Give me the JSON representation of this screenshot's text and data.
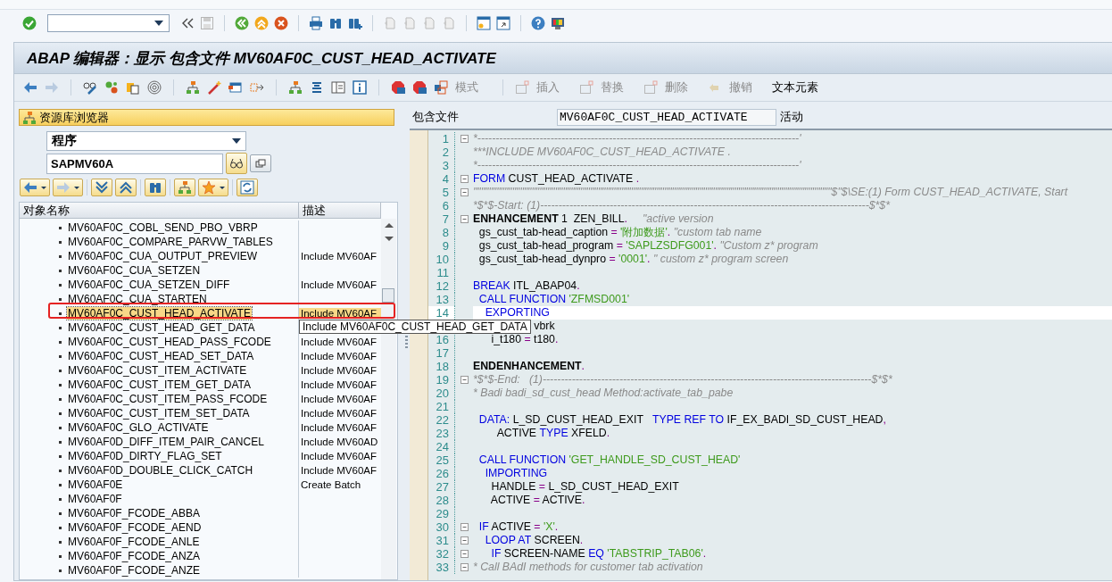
{
  "title": "ABAP 编辑器：显示 包含文件 MV60AF0C_CUST_HEAD_ACTIVATE",
  "app_toolbar": [
    {
      "label": "模式",
      "disabled": true
    },
    {
      "label": "插入",
      "disabled": true
    },
    {
      "label": "替换",
      "disabled": true
    },
    {
      "label": "删除",
      "disabled": true
    },
    {
      "label": "撤销",
      "disabled": true
    },
    {
      "label": "文本元素",
      "disabled": false
    }
  ],
  "repository_browser": {
    "title": "资源库浏览器",
    "object_type": "程序",
    "object_name": "SAPMV60A",
    "columns": [
      "对象名称",
      "描述"
    ],
    "rows": [
      {
        "name": "MV60AF0C_COBL_SEND_PBO_VBRP",
        "selected": false
      },
      {
        "name": "MV60AF0C_COMPARE_PARVW_TABLES",
        "selected": false
      },
      {
        "name": "MV60AF0C_CUA_OUTPUT_PREVIEW",
        "description": "Include MV60AF",
        "selected": false
      },
      {
        "name": "MV60AF0C_CUA_SETZEN",
        "selected": false
      },
      {
        "name": "MV60AF0C_CUA_SETZEN_DIFF",
        "description": "Include MV60AF",
        "selected": false
      },
      {
        "name": "MV60AF0C_CUA_STARTEN",
        "selected": false
      },
      {
        "name": "MV60AF0C_CUST_HEAD_ACTIVATE",
        "description": "Include MV60AF",
        "selected": true
      },
      {
        "name": "MV60AF0C_CUST_HEAD_GET_DATA",
        "tooltip": "Include MV60AF0C_CUST_HEAD_GET_DATA",
        "selected": false
      },
      {
        "name": "MV60AF0C_CUST_HEAD_PASS_FCODE",
        "description": "Include MV60AF",
        "selected": false
      },
      {
        "name": "MV60AF0C_CUST_HEAD_SET_DATA",
        "description": "Include MV60AF",
        "selected": false
      },
      {
        "name": "MV60AF0C_CUST_ITEM_ACTIVATE",
        "description": "Include MV60AF",
        "selected": false
      },
      {
        "name": "MV60AF0C_CUST_ITEM_GET_DATA",
        "description": "Include MV60AF",
        "selected": false
      },
      {
        "name": "MV60AF0C_CUST_ITEM_PASS_FCODE",
        "description": "Include MV60AF",
        "selected": false
      },
      {
        "name": "MV60AF0C_CUST_ITEM_SET_DATA",
        "description": "Include MV60AF",
        "selected": false
      },
      {
        "name": "MV60AF0C_GLO_ACTIVATE",
        "description": "Include MV60AF",
        "selected": false
      },
      {
        "name": "MV60AF0D_DIFF_ITEM_PAIR_CANCEL",
        "description": "Include MV60AD",
        "selected": false
      },
      {
        "name": "MV60AF0D_DIRTY_FLAG_SET",
        "description": "Include MV60AF",
        "selected": false
      },
      {
        "name": "MV60AF0D_DOUBLE_CLICK_CATCH",
        "description": "Include MV60AF",
        "selected": false
      },
      {
        "name": "MV60AF0E",
        "description": "Create Batch",
        "selected": false
      },
      {
        "name": "MV60AF0F",
        "selected": false
      },
      {
        "name": "MV60AF0F_FCODE_ABBA",
        "selected": false
      },
      {
        "name": "MV60AF0F_FCODE_AEND",
        "selected": false
      },
      {
        "name": "MV60AF0F_FCODE_ANLE",
        "selected": false
      },
      {
        "name": "MV60AF0F_FCODE_ANZA",
        "selected": false
      },
      {
        "name": "MV60AF0F_FCODE_ANZE",
        "selected": false
      }
    ]
  },
  "editor": {
    "include_label": "包含文件",
    "include_name": "MV60AF0C_CUST_HEAD_ACTIVATE",
    "status": "活动",
    "lines": [
      {
        "number": "1",
        "fold": true,
        "current": false,
        "tokens": [
          {
            "kind": "comment",
            "text": "*----------------------------------------------------------------------------------------'"
          }
        ]
      },
      {
        "number": "2",
        "fold": false,
        "current": false,
        "tokens": [
          {
            "kind": "comment",
            "text": "***INCLUDE MV60AF0C_CUST_HEAD_ACTIVATE ."
          }
        ]
      },
      {
        "number": "3",
        "fold": false,
        "current": false,
        "tokens": [
          {
            "kind": "comment",
            "text": "*----------------------------------------------------------------------------------------'"
          }
        ]
      },
      {
        "number": "4",
        "fold": true,
        "current": false,
        "tokens": [
          {
            "kind": "keyword",
            "text": "FORM"
          },
          {
            "kind": "plain",
            "text": " CUST_HEAD_ACTIVATE "
          },
          {
            "kind": "op",
            "text": "."
          }
        ]
      },
      {
        "number": "5",
        "fold": true,
        "current": false,
        "tokens": [
          {
            "kind": "comment",
            "text": "\"\"\"\"\"\"\"\"\"\"\"\"\"\"\"\"\"\"\"\"\"\"\"\"\"\"\"\"\"\"\"\"\"\"\"\"\"\"\"\"\"\"\"\"\"\"\"\"\"\"\"\"\"\"\"\"\"\"\"\"\"\"\"\"\"\"\"\"\"\"\"\"\"\"\"\"\"\"\"\"\"\"\"\"\"\"\"\"\"\"\"\"$\"$\\SE:(1) Form CUST_HEAD_ACTIVATE, Start"
          }
        ]
      },
      {
        "number": "6",
        "fold": false,
        "current": false,
        "tokens": [
          {
            "kind": "comment",
            "text": "*$*$-Start: (1)------------------------------------------------------------------------------------------$*$*"
          }
        ]
      },
      {
        "number": "7",
        "fold": true,
        "current": false,
        "tokens": [
          {
            "kind": "bold",
            "text": "ENHANCEMENT"
          },
          {
            "kind": "plain",
            "text": " 1  ZEN_BILL"
          },
          {
            "kind": "op",
            "text": "."
          },
          {
            "kind": "comment",
            "text": "     \"active version"
          }
        ]
      },
      {
        "number": "8",
        "fold": false,
        "current": false,
        "tokens": [
          {
            "kind": "plain",
            "text": "  gs_cust_tab-head_caption "
          },
          {
            "kind": "op",
            "text": "="
          },
          {
            "kind": "string",
            "text": " '附加数据'"
          },
          {
            "kind": "op",
            "text": "."
          },
          {
            "kind": "comment",
            "text": " \"custom tab name"
          }
        ]
      },
      {
        "number": "9",
        "fold": false,
        "current": false,
        "tokens": [
          {
            "kind": "plain",
            "text": "  gs_cust_tab-head_program "
          },
          {
            "kind": "op",
            "text": "="
          },
          {
            "kind": "string",
            "text": " 'SAPLZSDFG001'"
          },
          {
            "kind": "op",
            "text": "."
          },
          {
            "kind": "comment",
            "text": " \"Custom z* program"
          }
        ]
      },
      {
        "number": "10",
        "fold": false,
        "current": false,
        "tokens": [
          {
            "kind": "plain",
            "text": "  gs_cust_tab-head_dynpro "
          },
          {
            "kind": "op",
            "text": "="
          },
          {
            "kind": "string",
            "text": " '0001'"
          },
          {
            "kind": "op",
            "text": "."
          },
          {
            "kind": "comment",
            "text": " \" custom z* program screen"
          }
        ]
      },
      {
        "number": "11",
        "fold": false,
        "current": false
      },
      {
        "number": "12",
        "fold": false,
        "current": false,
        "tokens": [
          {
            "kind": "keyword",
            "text": "BREAK"
          },
          {
            "kind": "plain",
            "text": " ITL_ABAP04"
          },
          {
            "kind": "op",
            "text": "."
          }
        ]
      },
      {
        "number": "13",
        "fold": false,
        "current": false,
        "tokens": [
          {
            "kind": "keyword",
            "text": "  CALL FUNCTION"
          },
          {
            "kind": "string",
            "text": " 'ZFMSD001'"
          }
        ]
      },
      {
        "number": "14",
        "fold": false,
        "current": true,
        "tokens": [
          {
            "kind": "keyword",
            "text": "    EXPORTING"
          }
        ]
      },
      {
        "fold": false,
        "current": false,
        "tokens": [
          {
            "kind": "plain",
            "text": "                    vbrk"
          }
        ]
      },
      {
        "number": "16",
        "fold": false,
        "current": false,
        "tokens": [
          {
            "kind": "plain",
            "text": "      i_t180 "
          },
          {
            "kind": "op",
            "text": "="
          },
          {
            "kind": "plain",
            "text": " t180"
          },
          {
            "kind": "op",
            "text": "."
          }
        ]
      },
      {
        "number": "17",
        "fold": false,
        "current": false
      },
      {
        "number": "18",
        "fold": false,
        "current": false,
        "tokens": [
          {
            "kind": "bold",
            "text": "ENDENHANCEMENT"
          },
          {
            "kind": "op",
            "text": "."
          }
        ]
      },
      {
        "number": "19",
        "fold": true,
        "current": false,
        "tokens": [
          {
            "kind": "comment",
            "text": "*$*$-End:   (1)------------------------------------------------------------------------------------------$*$*"
          }
        ]
      },
      {
        "number": "20",
        "fold": false,
        "current": false,
        "tokens": [
          {
            "kind": "comment",
            "text": "* Badi badi_sd_cust_head Method:activate_tab_pabe"
          }
        ]
      },
      {
        "number": "21",
        "fold": false,
        "current": false
      },
      {
        "number": "22",
        "fold": false,
        "current": false,
        "tokens": [
          {
            "kind": "keyword",
            "text": "  DATA:"
          },
          {
            "kind": "plain",
            "text": " L_SD_CUST_HEAD_EXIT   "
          },
          {
            "kind": "keyword",
            "text": "TYPE REF TO"
          },
          {
            "kind": "plain",
            "text": " IF_EX_BADI_SD_CUST_HEAD"
          },
          {
            "kind": "op",
            "text": ","
          }
        ]
      },
      {
        "number": "23",
        "fold": false,
        "current": false,
        "tokens": [
          {
            "kind": "plain",
            "text": "        ACTIVE "
          },
          {
            "kind": "keyword",
            "text": "TYPE"
          },
          {
            "kind": "plain",
            "text": " XFELD"
          },
          {
            "kind": "op",
            "text": "."
          }
        ]
      },
      {
        "number": "24",
        "fold": false,
        "current": false
      },
      {
        "number": "25",
        "fold": false,
        "current": false,
        "tokens": [
          {
            "kind": "keyword",
            "text": "  CALL FUNCTION"
          },
          {
            "kind": "string",
            "text": " 'GET_HANDLE_SD_CUST_HEAD'"
          }
        ]
      },
      {
        "number": "26",
        "fold": false,
        "current": false,
        "tokens": [
          {
            "kind": "keyword",
            "text": "    IMPORTING"
          }
        ]
      },
      {
        "number": "27",
        "fold": false,
        "current": false,
        "tokens": [
          {
            "kind": "plain",
            "text": "      HANDLE "
          },
          {
            "kind": "op",
            "text": "="
          },
          {
            "kind": "plain",
            "text": " L_SD_CUST_HEAD_EXIT"
          }
        ]
      },
      {
        "number": "28",
        "fold": false,
        "current": false,
        "tokens": [
          {
            "kind": "plain",
            "text": "      ACTIVE "
          },
          {
            "kind": "op",
            "text": "="
          },
          {
            "kind": "plain",
            "text": " ACTIVE"
          },
          {
            "kind": "op",
            "text": "."
          }
        ]
      },
      {
        "number": "29",
        "fold": false,
        "current": false
      },
      {
        "number": "30",
        "fold": true,
        "current": false,
        "tokens": [
          {
            "kind": "keyword",
            "text": "  IF"
          },
          {
            "kind": "plain",
            "text": " ACTIVE "
          },
          {
            "kind": "op",
            "text": "="
          },
          {
            "kind": "string",
            "text": " 'X'"
          },
          {
            "kind": "op",
            "text": "."
          }
        ]
      },
      {
        "number": "31",
        "fold": true,
        "current": false,
        "tokens": [
          {
            "kind": "keyword",
            "text": "    LOOP AT"
          },
          {
            "kind": "plain",
            "text": " SCREEN"
          },
          {
            "kind": "op",
            "text": "."
          }
        ]
      },
      {
        "number": "32",
        "fold": true,
        "current": false,
        "tokens": [
          {
            "kind": "keyword",
            "text": "      IF"
          },
          {
            "kind": "plain",
            "text": " SCREEN-NAME "
          },
          {
            "kind": "keyword",
            "text": "EQ"
          },
          {
            "kind": "string",
            "text": " 'TABSTRIP_TAB06'"
          },
          {
            "kind": "op",
            "text": "."
          }
        ]
      },
      {
        "number": "33",
        "fold": true,
        "current": false,
        "tokens": [
          {
            "kind": "comment",
            "text": "* Call BAdI methods for customer tab activation"
          }
        ]
      }
    ]
  }
}
